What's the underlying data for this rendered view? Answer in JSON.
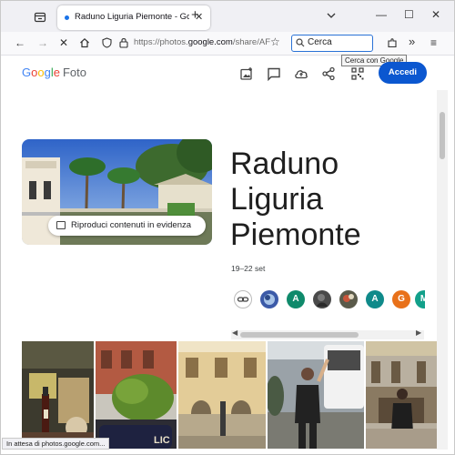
{
  "browser": {
    "tab_title": "Raduno Liguria Piemonte - Goo",
    "url_prefix": "https://photos.",
    "url_domain": "google.com",
    "url_path": "/share/AF",
    "search_value": "Cerca",
    "search_tooltip": "Cerca con Google",
    "status_text": "In attesa di photos.google.com...",
    "accent_color": "#2a72d6"
  },
  "header": {
    "logo_google": "Google",
    "logo_product": "Foto",
    "signin_label": "Accedi",
    "signin_color": "#0b57d0",
    "icons": [
      "add-photo-icon",
      "comment-icon",
      "cloud-upload-icon",
      "share-icon",
      "qr-code-icon"
    ]
  },
  "album": {
    "title_lines": [
      "Raduno",
      "Liguria",
      "Piemonte"
    ],
    "date": "19–22 set",
    "highlight_label": "Riproduci contenuti in evidenza",
    "people": [
      {
        "letter": "",
        "color": "#ffffff"
      },
      {
        "letter": "",
        "color": "#3b5aa8"
      },
      {
        "letter": "A",
        "color": "#0f8a6b"
      },
      {
        "letter": "",
        "color": "#555555"
      },
      {
        "letter": "",
        "color": "#8a4a3a"
      },
      {
        "letter": "A",
        "color": "#0f8a8a"
      },
      {
        "letter": "G",
        "color": "#e8711a"
      },
      {
        "letter": "M",
        "color": "#12a08a"
      }
    ]
  }
}
